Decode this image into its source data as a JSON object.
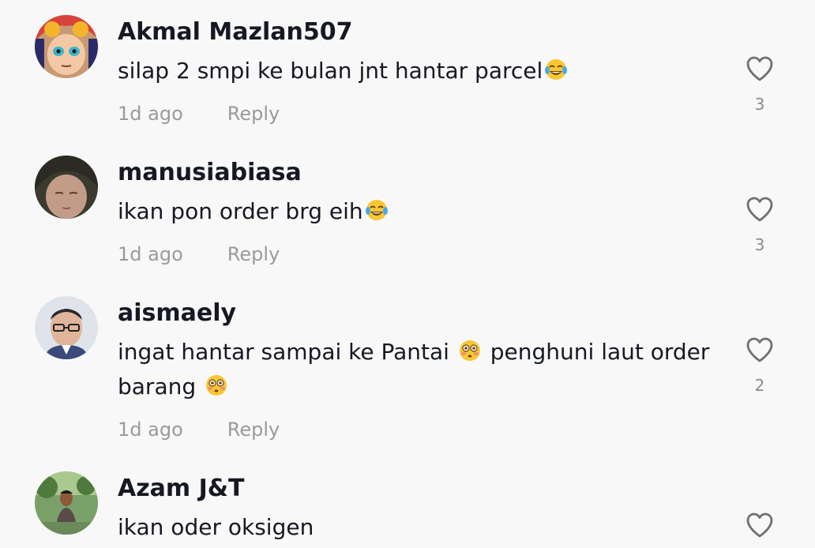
{
  "comments": [
    {
      "username": "Akmal Mazlan507",
      "text_before": "silap 2 smpi ke bulan jnt hantar parcel",
      "emoji": "😂",
      "text_after": "",
      "time": "1d ago",
      "reply": "Reply",
      "likes": "3"
    },
    {
      "username": "manusiabiasa",
      "text_before": "ikan pon order brg eih",
      "emoji": "😂",
      "text_after": "",
      "time": "1d ago",
      "reply": "Reply",
      "likes": "3"
    },
    {
      "username": "aismaely",
      "text_before": "ingat hantar sampai ke Pantai ",
      "emoji": "😳",
      "text_middle": " penghuni laut order barang ",
      "emoji2": "😳",
      "time": "1d ago",
      "reply": "Reply",
      "likes": "2"
    },
    {
      "username": "Azam J&T",
      "text_before": "ikan oder oksigen"
    }
  ],
  "icons": {
    "like": "heart-outline-icon",
    "laugh": "face-with-tears-of-joy-emoji",
    "flushed": "flushed-face-emoji"
  },
  "colors": {
    "background": "#f8f8f8",
    "username": "#161823",
    "meta": "#9a9a9e"
  }
}
